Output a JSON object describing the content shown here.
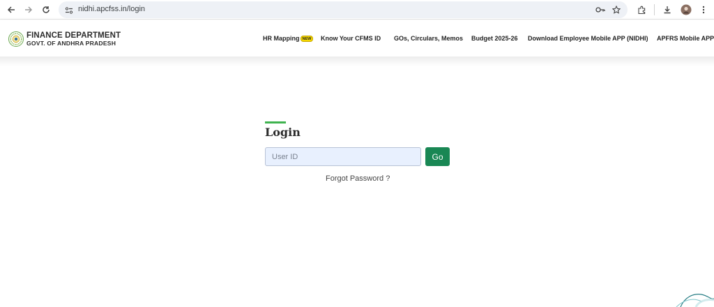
{
  "browser": {
    "url": "nidhi.apcfss.in/login",
    "icons": [
      "back-arrow-icon",
      "forward-arrow-icon",
      "reload-icon",
      "site-info-icon",
      "password-key-icon",
      "bookmark-star-icon",
      "extensions-icon",
      "download-icon",
      "profile-avatar",
      "menu-kebab-icon"
    ]
  },
  "header": {
    "brand_title": "FINANCE DEPARTMENT",
    "brand_subtitle": "GOVT. OF ANDHRA PRADESH",
    "nav": [
      {
        "label": "HR Mapping",
        "badge": "NEW"
      },
      {
        "label": "Know Your CFMS ID"
      },
      {
        "label": "GOs, Circulars, Memos"
      },
      {
        "label": "Budget 2025-26"
      },
      {
        "label": "Download Employee Mobile APP (NIDHI)"
      },
      {
        "label": "APFRS Mobile APP"
      }
    ]
  },
  "login": {
    "title": "Login",
    "user_id_placeholder": "User ID",
    "user_id_value": "",
    "go_label": "Go",
    "forgot_label": "Forgot Password ?"
  },
  "colors": {
    "accent_green": "#3fb34f",
    "button_green": "#198754",
    "badge_yellow": "#f5d800"
  }
}
